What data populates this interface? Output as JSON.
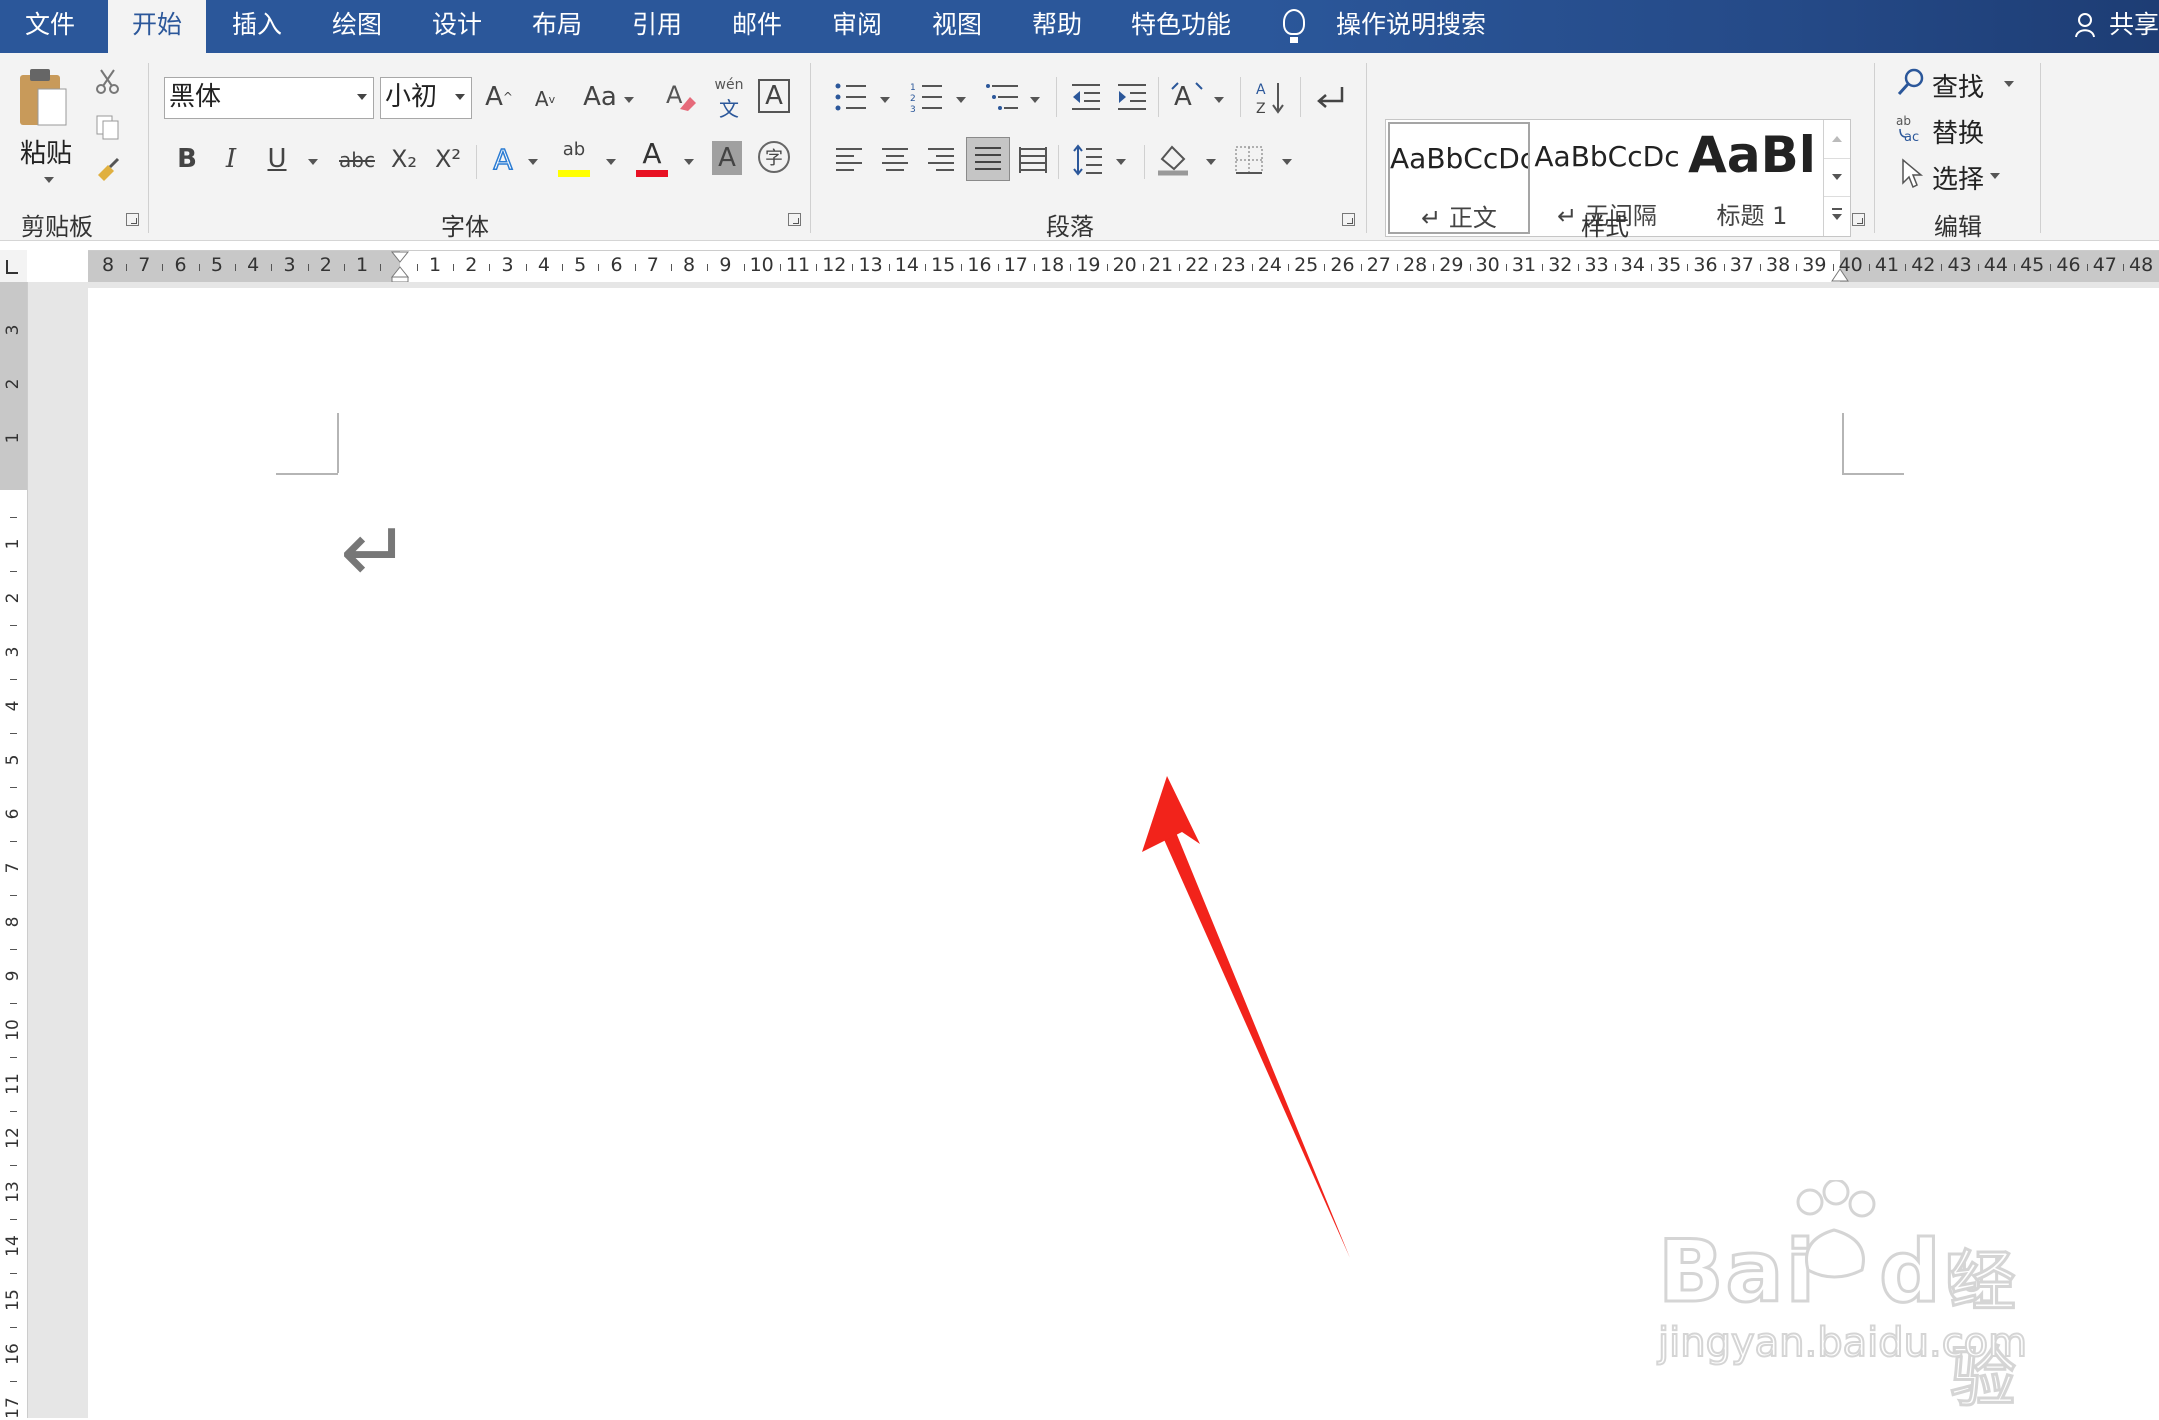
{
  "tabs": {
    "file": "文件",
    "home": "开始",
    "insert": "插入",
    "draw": "绘图",
    "design": "设计",
    "layout": "布局",
    "references": "引用",
    "mailings": "邮件",
    "review": "审阅",
    "view": "视图",
    "help": "帮助",
    "features": "特色功能"
  },
  "tell_me": "操作说明搜索",
  "share": "共享",
  "clipboard": {
    "paste": "粘贴",
    "label": "剪贴板"
  },
  "font": {
    "name": "黑体",
    "size": "小初",
    "label": "字体",
    "grow": "A",
    "shrink": "A",
    "case": "Aa",
    "phonetic_top": "wén",
    "phonetic_bottom": "文",
    "border_a": "A",
    "bold": "B",
    "italic": "I",
    "underline": "U",
    "strike": "abc",
    "sub": "X₂",
    "sup": "X²",
    "effects": "A",
    "highlight": "ab",
    "color": "A",
    "shade": "A",
    "enclose": "字"
  },
  "paragraph": {
    "label": "段落"
  },
  "styles": {
    "label": "样式",
    "items": [
      {
        "sample": "AaBbCcDc",
        "name": "↵ 正文"
      },
      {
        "sample": "AaBbCcDc",
        "name": "↵ 无间隔"
      },
      {
        "sample": "AaBl",
        "name": "标题 1"
      }
    ]
  },
  "editing": {
    "find": "查找",
    "replace": "替换",
    "select": "选择",
    "label": "编辑"
  },
  "ruler": {
    "h_left": [
      "8",
      "7",
      "6",
      "5",
      "4",
      "3",
      "2",
      "1"
    ],
    "h_right": [
      "1",
      "2",
      "3",
      "4",
      "5",
      "6",
      "7",
      "8",
      "9",
      "10",
      "11",
      "12",
      "13",
      "14",
      "15",
      "16",
      "17",
      "18",
      "19",
      "20",
      "21",
      "22",
      "23",
      "24",
      "25",
      "26",
      "27",
      "28",
      "29",
      "30",
      "31",
      "32",
      "33",
      "34",
      "35",
      "36",
      "37",
      "38",
      "39",
      "40",
      "41",
      "42",
      "43",
      "44",
      "45",
      "46",
      "47",
      "48"
    ],
    "v_top": [
      "3",
      "2",
      "1"
    ],
    "v_bottom": [
      "1",
      "2",
      "3",
      "4",
      "5",
      "6",
      "7",
      "8",
      "9",
      "10",
      "11",
      "12",
      "13",
      "14",
      "15",
      "16",
      "17"
    ]
  },
  "document": {
    "paragraph_mark": "↵"
  },
  "watermark": {
    "brand": "Bai",
    "brand2": "du",
    "cn": "经验",
    "url": "jingyan.baidu.com"
  },
  "colors": {
    "accent": "#2b579a",
    "highlight": "#ffff00",
    "font_color": "#e81123",
    "arrow": "#f2231b"
  }
}
